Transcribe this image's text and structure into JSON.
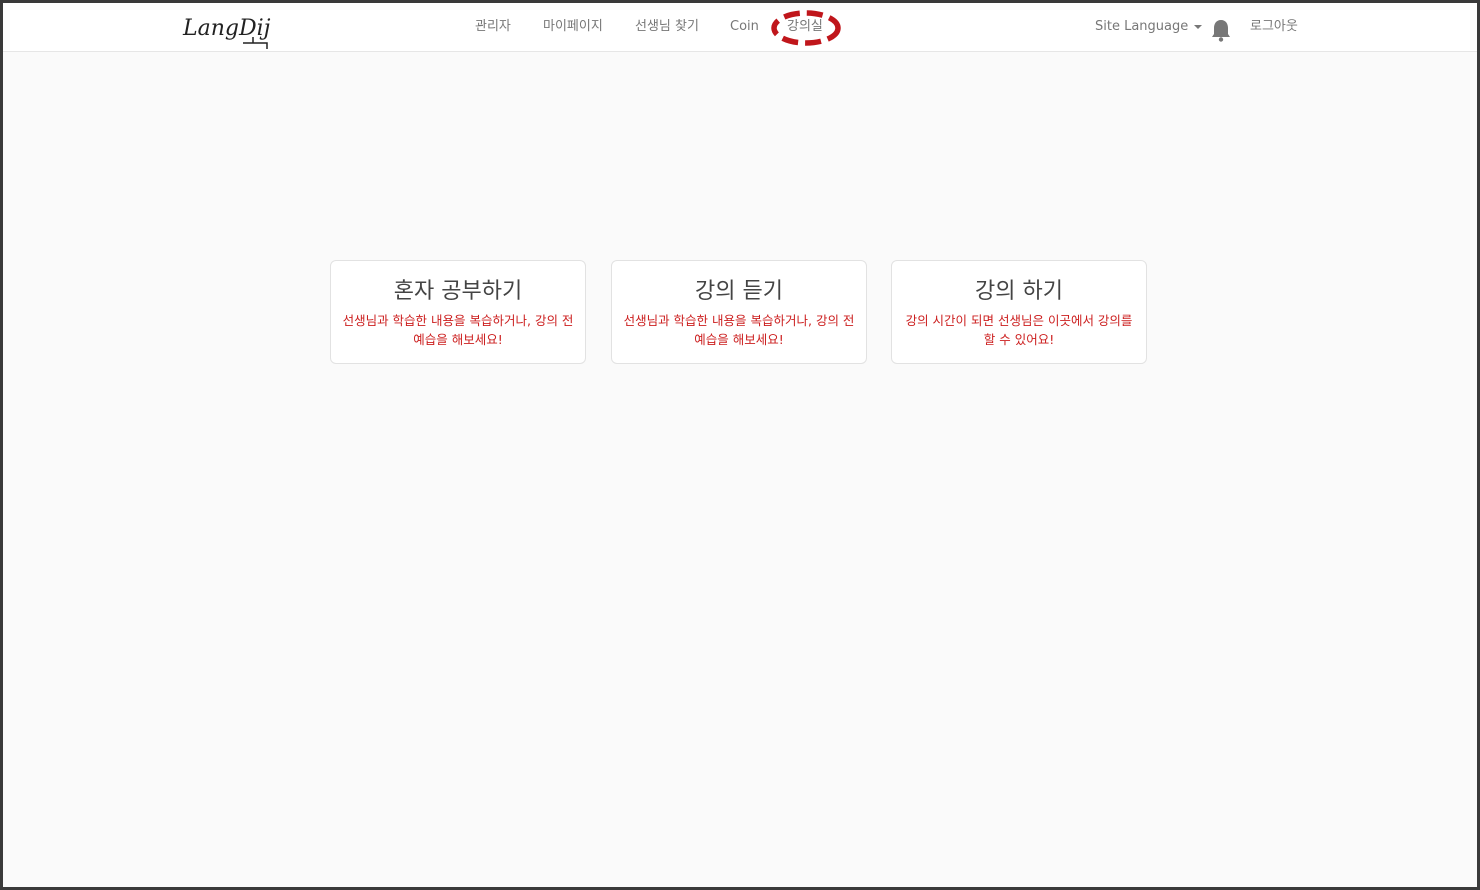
{
  "brand": {
    "logo_text": "LangDij"
  },
  "nav": {
    "items": [
      {
        "label": "관리자"
      },
      {
        "label": "마이페이지"
      },
      {
        "label": "선생님 찾기"
      },
      {
        "label": "Coin"
      },
      {
        "label": "강의실"
      }
    ],
    "active_item": "강의실",
    "site_language_label": "Site Language",
    "logout_label": "로그아웃"
  },
  "cards": [
    {
      "title": "혼자 공부하기",
      "desc_line1": "선생님과 학습한 내용을 복습하거나, 강의 전",
      "desc_line2": "예습을 해보세요!"
    },
    {
      "title": "강의 듣기",
      "desc_line1": "선생님과 학습한 내용을 복습하거나, 강의 전",
      "desc_line2": "예습을 해보세요!"
    },
    {
      "title": "강의 하기",
      "desc_line1": "강의 시간이 되면 선생님은 이곳에서 강의를",
      "desc_line2": "할 수 있어요!"
    }
  ],
  "colors": {
    "accent_red": "#cc1f1f",
    "nav_text": "#777777",
    "annotation_red": "#c0161b"
  },
  "icons": {
    "notifications": "bell-icon",
    "language_dropdown": "caret-down-icon"
  }
}
